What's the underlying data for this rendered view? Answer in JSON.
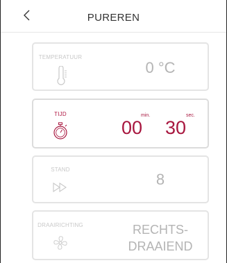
{
  "header": {
    "title": "PUREREN",
    "back_icon": "chevron-left-icon"
  },
  "cards": {
    "temperature": {
      "label": "TEMPERATUUR",
      "icon": "thermometer-icon",
      "value": "0 °C"
    },
    "time": {
      "label": "TIJD",
      "icon": "stopwatch-icon",
      "minutes": "00",
      "minutes_unit": "min.",
      "seconds": "30",
      "seconds_unit": "sec."
    },
    "speed": {
      "label": "STAND",
      "icon": "fast-forward-icon",
      "value": "8"
    },
    "direction": {
      "label": "DRAAIRICHTING",
      "icon": "fan-icon",
      "value_line1": "RECHTS-",
      "value_line2": "DRAAIEND"
    }
  },
  "colors": {
    "accent": "#a8173f",
    "inactive_text": "#b4b4b4",
    "card_border": "#e4e4e4"
  }
}
